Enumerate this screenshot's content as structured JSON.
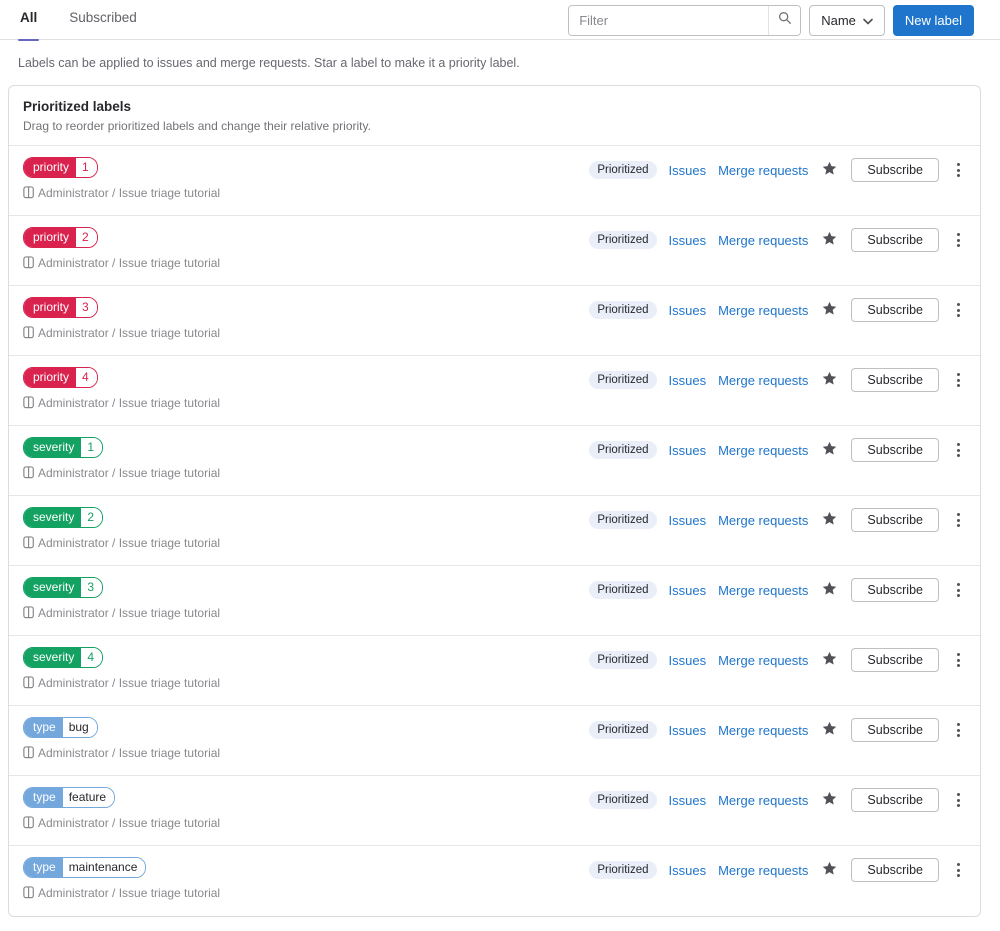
{
  "tabs": [
    {
      "label": "All",
      "active": true
    },
    {
      "label": "Subscribed",
      "active": false
    }
  ],
  "toolbar": {
    "filter_placeholder": "Filter",
    "sort_label": "Name",
    "new_label": "New label"
  },
  "description": "Labels can be applied to issues and merge requests. Star a label to make it a priority label.",
  "card": {
    "title": "Prioritized labels",
    "subtitle": "Drag to reorder prioritized labels and change their relative priority."
  },
  "row_actions": {
    "prioritized": "Prioritized",
    "issues": "Issues",
    "merge_requests": "Merge requests",
    "subscribe": "Subscribe"
  },
  "project_path": "Administrator / Issue triage tutorial",
  "labels": [
    {
      "scope": "priority",
      "value": "1",
      "color": "#d9234e",
      "value_text_color": "#d9234e"
    },
    {
      "scope": "priority",
      "value": "2",
      "color": "#d9234e",
      "value_text_color": "#d9234e"
    },
    {
      "scope": "priority",
      "value": "3",
      "color": "#d9234e",
      "value_text_color": "#d9234e"
    },
    {
      "scope": "priority",
      "value": "4",
      "color": "#d9234e",
      "value_text_color": "#d9234e"
    },
    {
      "scope": "severity",
      "value": "1",
      "color": "#14a263",
      "value_text_color": "#14a263"
    },
    {
      "scope": "severity",
      "value": "2",
      "color": "#14a263",
      "value_text_color": "#14a263"
    },
    {
      "scope": "severity",
      "value": "3",
      "color": "#14a263",
      "value_text_color": "#14a263"
    },
    {
      "scope": "severity",
      "value": "4",
      "color": "#14a263",
      "value_text_color": "#14a263"
    },
    {
      "scope": "type",
      "value": "bug",
      "color": "#74a8dc",
      "value_text_color": "#28272d"
    },
    {
      "scope": "type",
      "value": "feature",
      "color": "#74a8dc",
      "value_text_color": "#28272d"
    },
    {
      "scope": "type",
      "value": "maintenance",
      "color": "#74a8dc",
      "value_text_color": "#28272d"
    }
  ],
  "colors": {
    "link": "#1f75cb",
    "primary_button": "#1f75cb",
    "active_tab_underline": "#6666c4",
    "badge_bg": "#e9eef8"
  }
}
